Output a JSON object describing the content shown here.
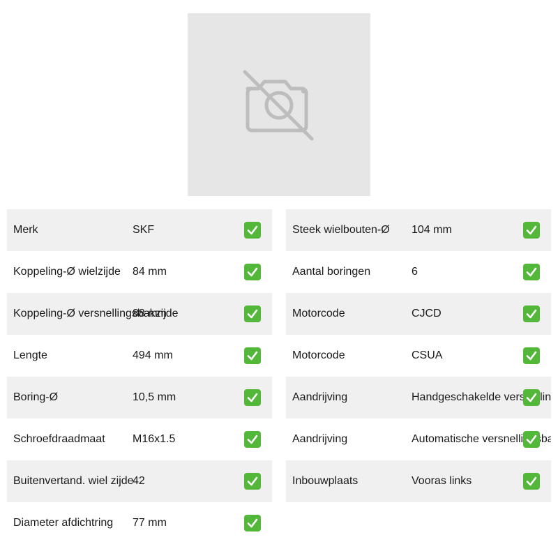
{
  "colors": {
    "check_green": "#53b83a",
    "row_alt": "#f0f0f0",
    "placeholder_bg": "#e6e6e6",
    "placeholder_icon": "#bdbdbd"
  },
  "image": {
    "icon": "no-camera-icon"
  },
  "left_specs": [
    {
      "label": "Merk",
      "value": "SKF"
    },
    {
      "label": "Koppeling-Ø wielzijde",
      "value": "84 mm"
    },
    {
      "label": "Koppeling-Ø versnellingsbakzijde",
      "value": "88 mm"
    },
    {
      "label": "Lengte",
      "value": "494 mm"
    },
    {
      "label": "Boring-Ø",
      "value": "10,5 mm"
    },
    {
      "label": "Schroefdraadmaat",
      "value": "M16x1.5"
    },
    {
      "label": "Buitenvertand. wiel zijde",
      "value": "42"
    },
    {
      "label": "Diameter afdichtring",
      "value": "77 mm"
    }
  ],
  "right_specs": [
    {
      "label": "Steek wielbouten-Ø",
      "value": "104 mm"
    },
    {
      "label": "Aantal boringen",
      "value": "6"
    },
    {
      "label": "Motorcode",
      "value": "CJCD"
    },
    {
      "label": "Motorcode",
      "value": "CSUA"
    },
    {
      "label": "Aandrijving",
      "value": "Handgeschakelde versnellingsbak"
    },
    {
      "label": "Aandrijving",
      "value": "Automatische versnellingsbak"
    },
    {
      "label": "Inbouwplaats",
      "value": "Vooras links"
    }
  ],
  "status_icon": "checkmark-icon"
}
